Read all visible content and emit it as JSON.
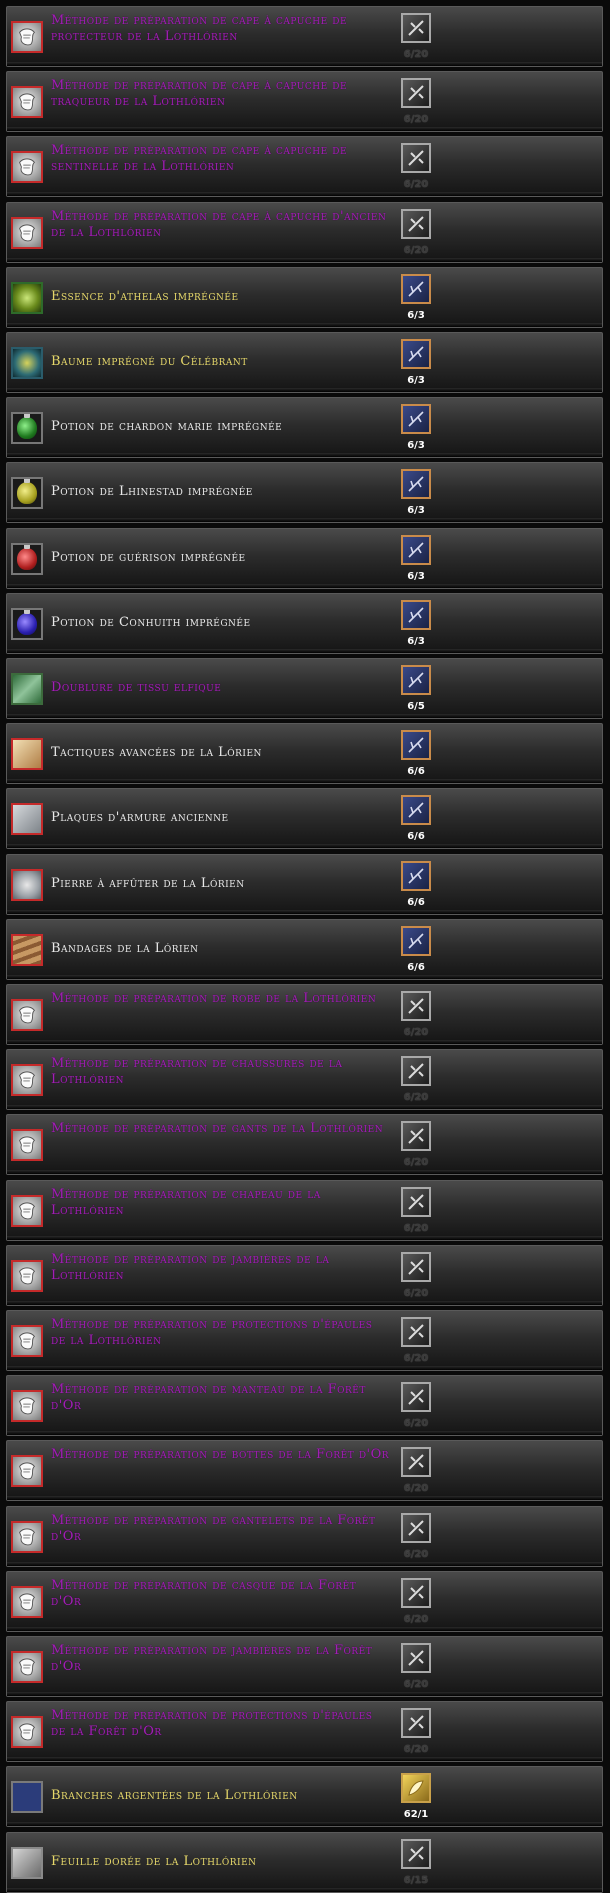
{
  "recipes": [
    {
      "label": "Méthode de préparation de cape à capuche de protecteur de la Lothlórien",
      "color": "purple",
      "icon": "scroll-icon",
      "resource": "tool-icon",
      "count": "6/20",
      "count_style": "dim"
    },
    {
      "label": "Méthode de préparation de cape à capuche de traqueur de la Lothlórien",
      "color": "purple",
      "icon": "scroll-icon",
      "resource": "tool-icon",
      "count": "6/20",
      "count_style": "dim"
    },
    {
      "label": "Méthode de préparation de cape à capuche de sentinelle de la Lothlórien",
      "color": "purple",
      "icon": "scroll-icon",
      "resource": "tool-icon",
      "count": "6/20",
      "count_style": "dim"
    },
    {
      "label": "Méthode de préparation de cape à capuche d'ancien de la Lothlórien",
      "color": "purple",
      "icon": "scroll-icon",
      "resource": "tool-icon",
      "count": "6/20",
      "count_style": "dim"
    },
    {
      "label": "Essence d'athelas imprégnée",
      "color": "yellow",
      "icon": "athelas-icon",
      "resource": "branch-icon",
      "count": "6/3",
      "count_style": "white"
    },
    {
      "label": "Baume imprégné du Célébrant",
      "color": "yellow",
      "icon": "balm-icon",
      "resource": "branch-icon",
      "count": "6/3",
      "count_style": "white"
    },
    {
      "label": "Potion de chardon marie imprégnée",
      "color": "white",
      "icon": "green-potion-icon",
      "resource": "branch-icon",
      "count": "6/3",
      "count_style": "white"
    },
    {
      "label": "Potion de Lhinestad imprégnée",
      "color": "white",
      "icon": "yellow-potion-icon",
      "resource": "branch-icon",
      "count": "6/3",
      "count_style": "white"
    },
    {
      "label": "Potion de guérison imprégnée",
      "color": "white",
      "icon": "red-potion-icon",
      "resource": "branch-icon",
      "count": "6/3",
      "count_style": "white"
    },
    {
      "label": "Potion de Conhuith imprégnée",
      "color": "white",
      "icon": "blue-potion-icon",
      "resource": "branch-icon",
      "count": "6/3",
      "count_style": "white"
    },
    {
      "label": "Doublure de tissu elfique",
      "color": "purple",
      "icon": "cloth-icon",
      "resource": "branch-icon",
      "count": "6/5",
      "count_style": "white"
    },
    {
      "label": "Tactiques avancées de la Lórien",
      "color": "white",
      "icon": "book-icon",
      "resource": "branch-icon",
      "count": "6/6",
      "count_style": "white"
    },
    {
      "label": "Plaques d'armure ancienne",
      "color": "white",
      "icon": "armour-plate-icon",
      "resource": "branch-icon",
      "count": "6/6",
      "count_style": "white"
    },
    {
      "label": "Pierre à affûter de la Lórien",
      "color": "white",
      "icon": "whetstone-icon",
      "resource": "branch-icon",
      "count": "6/6",
      "count_style": "white"
    },
    {
      "label": "Bandages de la Lórien",
      "color": "white",
      "icon": "bandage-icon",
      "resource": "branch-icon",
      "count": "6/6",
      "count_style": "white"
    },
    {
      "label": "Méthode de préparation de robe de la Lothlórien",
      "color": "purple",
      "icon": "scroll-icon",
      "resource": "tool-icon",
      "count": "6/20",
      "count_style": "dim"
    },
    {
      "label": "Méthode de préparation de chaussures de la Lothlórien",
      "color": "purple",
      "icon": "scroll-icon",
      "resource": "tool-icon",
      "count": "6/20",
      "count_style": "dim"
    },
    {
      "label": "Méthode de préparation de gants de la Lothlórien",
      "color": "purple",
      "icon": "scroll-icon",
      "resource": "tool-icon",
      "count": "6/20",
      "count_style": "dim"
    },
    {
      "label": "Méthode de préparation de chapeau de la Lothlórien",
      "color": "purple",
      "icon": "scroll-icon",
      "resource": "tool-icon",
      "count": "6/20",
      "count_style": "dim"
    },
    {
      "label": "Méthode de préparation de jambières de la Lothlórien",
      "color": "purple",
      "icon": "scroll-icon",
      "resource": "tool-icon",
      "count": "6/20",
      "count_style": "dim"
    },
    {
      "label": "Méthode de préparation de protections d'épaules de la Lothlórien",
      "color": "purple",
      "icon": "scroll-icon",
      "resource": "tool-icon",
      "count": "6/20",
      "count_style": "dim"
    },
    {
      "label": "Méthode de préparation de manteau de la Forêt d'Or",
      "color": "purple",
      "icon": "scroll-icon",
      "resource": "tool-icon",
      "count": "6/20",
      "count_style": "dim"
    },
    {
      "label": "Méthode de préparation de bottes de la Forêt d'Or",
      "color": "purple",
      "icon": "scroll-icon",
      "resource": "tool-icon",
      "count": "6/20",
      "count_style": "dim"
    },
    {
      "label": "Méthode de préparation de gantelets de la Forêt d'Or",
      "color": "purple",
      "icon": "scroll-icon",
      "resource": "tool-icon",
      "count": "6/20",
      "count_style": "dim"
    },
    {
      "label": "Méthode de préparation de casque de la Forêt d'Or",
      "color": "purple",
      "icon": "scroll-icon",
      "resource": "tool-icon",
      "count": "6/20",
      "count_style": "dim"
    },
    {
      "label": "Méthode de préparation de jambières de la Forêt d'Or",
      "color": "purple",
      "icon": "scroll-icon",
      "resource": "tool-icon",
      "count": "6/20",
      "count_style": "dim"
    },
    {
      "label": "Méthode de préparation de protections d'épaules de la Forêt d'Or",
      "color": "purple",
      "icon": "scroll-icon",
      "resource": "tool-icon",
      "count": "6/20",
      "count_style": "dim"
    },
    {
      "label": "Branches argentées de la Lothlórien",
      "color": "yellow",
      "icon": "silver-branch-icon",
      "resource": "gold-leaf-icon",
      "count": "62/1",
      "count_style": "white"
    },
    {
      "label": "Feuille dorée de la Lothlórien",
      "color": "yellow",
      "icon": "leaf-icon",
      "resource": "tool-icon",
      "count": "6/15",
      "count_style": "dim"
    }
  ]
}
